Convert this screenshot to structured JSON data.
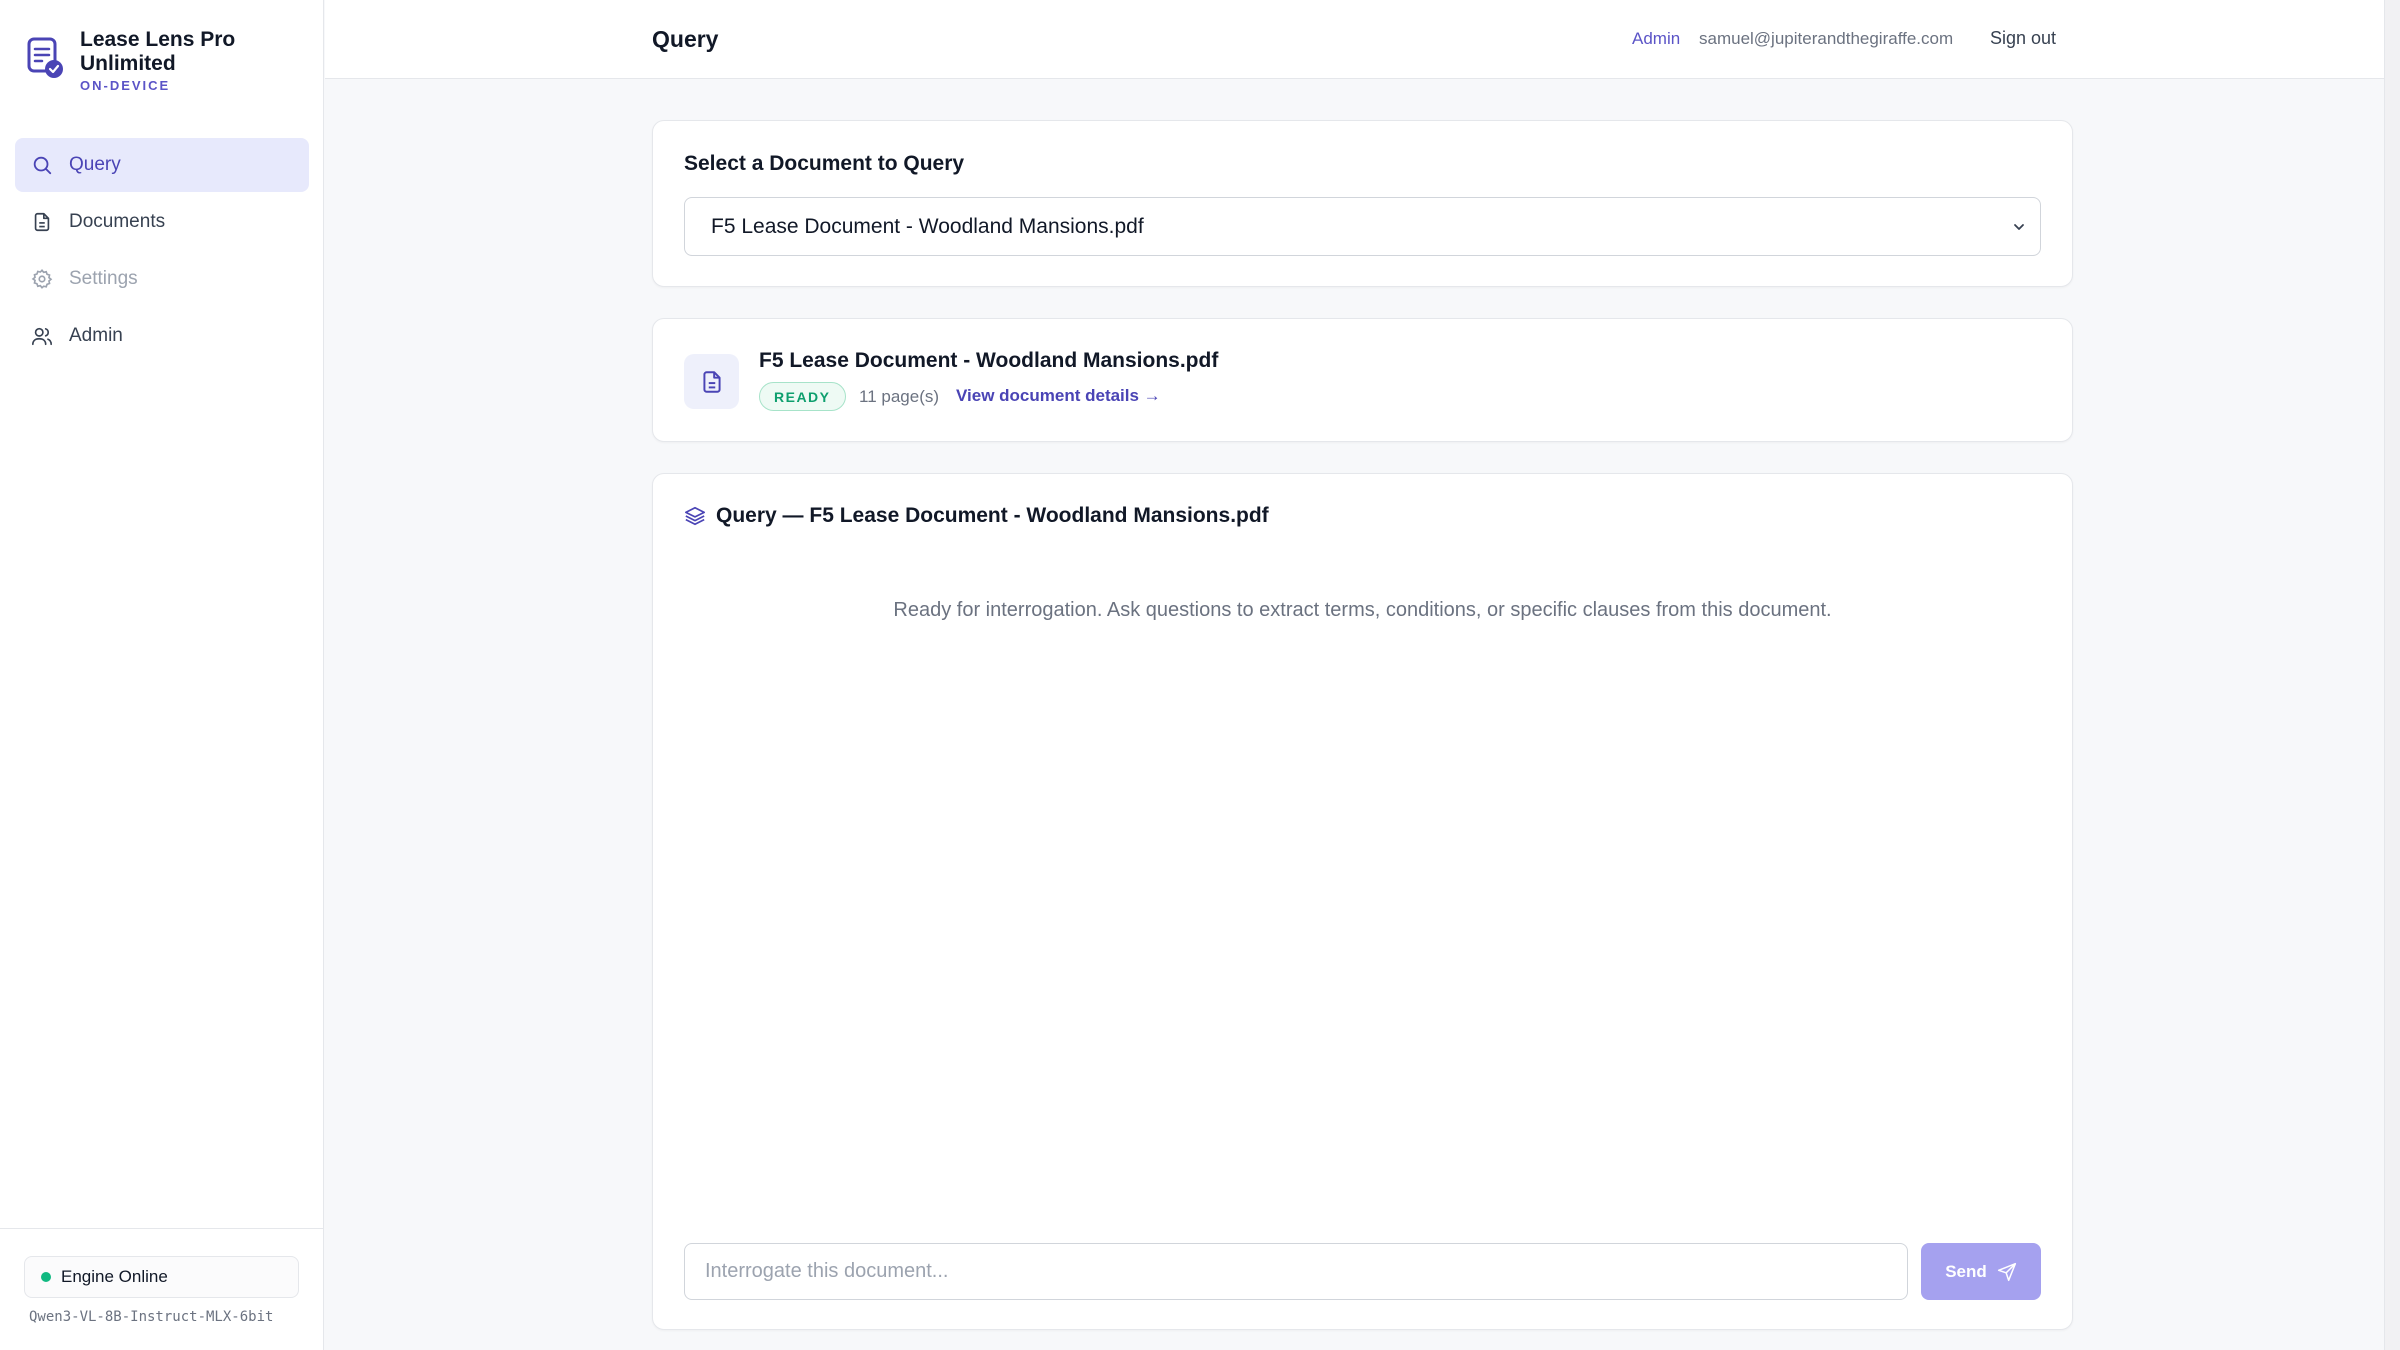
{
  "app": {
    "title": "Lease Lens Pro Unlimited",
    "subtitle": "ON-DEVICE"
  },
  "sidebar": {
    "items": [
      {
        "label": "Query",
        "icon": "search-icon",
        "active": true
      },
      {
        "label": "Documents",
        "icon": "document-icon",
        "active": false
      },
      {
        "label": "Settings",
        "icon": "gear-icon",
        "active": false
      },
      {
        "label": "Admin",
        "icon": "users-icon",
        "active": false
      }
    ],
    "engine_status": "Engine Online",
    "model_name": "Qwen3-VL-8B-Instruct-MLX-6bit"
  },
  "header": {
    "title": "Query",
    "role": "Admin",
    "email": "samuel@jupiterandthegiraffe.com",
    "sign_out": "Sign out"
  },
  "select_card": {
    "label": "Select a Document to Query",
    "selected_value": "F5 Lease Document - Woodland Mansions.pdf"
  },
  "doc_card": {
    "name": "F5 Lease Document - Woodland Mansions.pdf",
    "status": "READY",
    "pages": "11 page(s)",
    "details_link": "View document details →"
  },
  "query_card": {
    "title": "Query — F5 Lease Document - Woodland Mansions.pdf",
    "empty_message": "Ready for interrogation. Ask questions to extract terms, conditions, or specific clauses from this document.",
    "input_placeholder": "Interrogate this document...",
    "send_label": "Send"
  },
  "colors": {
    "accent": "#5b54c7",
    "active_bg": "#e7e9fc",
    "success": "#10b981",
    "send_disabled": "#a5a1ef"
  }
}
